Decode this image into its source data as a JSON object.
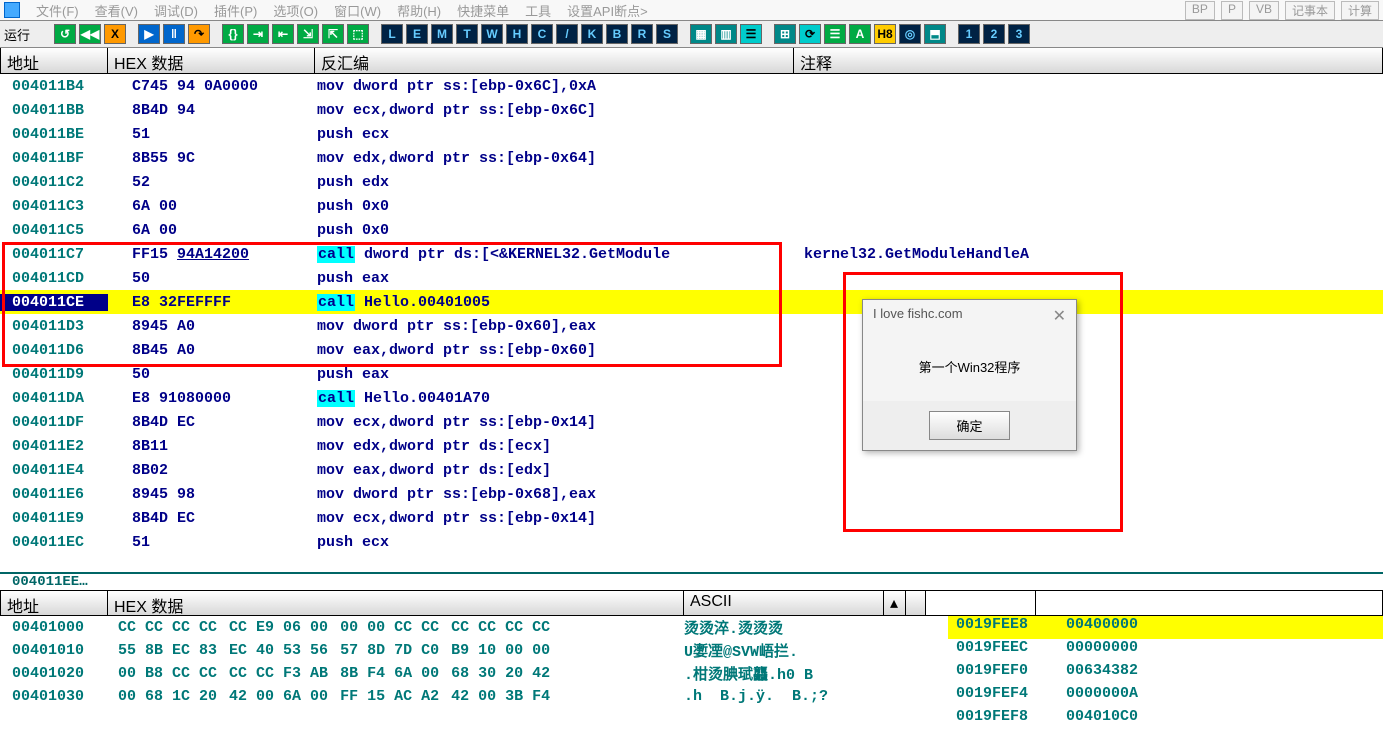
{
  "menu": {
    "items": [
      "文件(F)",
      "查看(V)",
      "调试(D)",
      "插件(P)",
      "选项(O)",
      "窗口(W)",
      "帮助(H)",
      "快捷菜单",
      "工具",
      "设置API断点>"
    ],
    "right": [
      "BP",
      "P",
      "VB",
      "记事本",
      "计算"
    ]
  },
  "toolbar": {
    "label": "运行",
    "buttons": [
      "↺",
      "◀◀",
      "X",
      "▶",
      "‖",
      "↷",
      "{}",
      "⇥",
      "⇤",
      "⇲",
      "⇱",
      "⬚",
      "L",
      "E",
      "M",
      "T",
      "W",
      "H",
      "C",
      "/",
      "K",
      "B",
      "R",
      "S",
      "▦",
      "▥",
      "☰",
      "⊞",
      "⟳",
      "☰",
      "A",
      "H8",
      "◎",
      "⬒",
      "1",
      "2",
      "3"
    ]
  },
  "headers": {
    "addr": "地址",
    "hex": "HEX 数据",
    "dis": "反汇编",
    "com": "注释"
  },
  "rows": [
    {
      "a": "004011B4",
      "h": "C745 94 0A0000",
      "d": "mov dword ptr ss:[ebp-0x6C],0xA",
      "c": ""
    },
    {
      "a": "004011BB",
      "h": "8B4D 94",
      "d": "mov ecx,dword ptr ss:[ebp-0x6C]",
      "c": ""
    },
    {
      "a": "004011BE",
      "h": "51",
      "d": "push ecx",
      "c": ""
    },
    {
      "a": "004011BF",
      "h": "8B55 9C",
      "d": "mov edx,dword ptr ss:[ebp-0x64]",
      "c": ""
    },
    {
      "a": "004011C2",
      "h": "52",
      "d": "push edx",
      "c": ""
    },
    {
      "a": "004011C3",
      "h": "6A 00",
      "d": "push 0x0",
      "c": ""
    },
    {
      "a": "004011C5",
      "h": "6A 00",
      "d": "push 0x0",
      "c": ""
    },
    {
      "a": "004011C7",
      "h": "FF15 ",
      "h2": "94A14200",
      "d1": "call",
      "d2": " dword ptr ds:[<&KERNEL32.GetModule",
      "c": "kernel32.GetModuleHandleA",
      "kw": true
    },
    {
      "a": "004011CD",
      "h": "50",
      "d": "push eax",
      "c": ""
    },
    {
      "a": "004011CE",
      "h": "E8 32FEFFFF",
      "d1": "call",
      "d2": " Hello.00401005",
      "c": "",
      "kw": true,
      "sel": true,
      "hl": true
    },
    {
      "a": "004011D3",
      "h": "8945 A0",
      "d": "mov dword ptr ss:[ebp-0x60],eax",
      "c": ""
    },
    {
      "a": "004011D6",
      "h": "8B45 A0",
      "d": "mov eax,dword ptr ss:[ebp-0x60]",
      "c": ""
    },
    {
      "a": "004011D9",
      "h": "50",
      "d": "push eax",
      "c": ""
    },
    {
      "a": "004011DA",
      "h": "E8 91080000",
      "d1": "call",
      "d2": " Hello.00401A70",
      "c": "",
      "kw": true
    },
    {
      "a": "004011DF",
      "h": "8B4D EC",
      "d": "mov ecx,dword ptr ss:[ebp-0x14]",
      "c": ""
    },
    {
      "a": "004011E2",
      "h": "8B11",
      "d": "mov edx,dword ptr ds:[ecx]",
      "c": ""
    },
    {
      "a": "004011E4",
      "h": "8B02",
      "d": "mov eax,dword ptr ds:[edx]",
      "c": ""
    },
    {
      "a": "004011E6",
      "h": "8945 98",
      "d": "mov dword ptr ss:[ebp-0x68],eax",
      "c": ""
    },
    {
      "a": "004011E9",
      "h": "8B4D EC",
      "d": "mov ecx,dword ptr ss:[ebp-0x14]",
      "c": ""
    },
    {
      "a": "004011EC",
      "h": "51",
      "d": "push ecx",
      "c": ""
    }
  ],
  "dumpHeaders": {
    "addr": "地址",
    "hex": "HEX 数据",
    "asc": "ASCII"
  },
  "dumpRows": [
    {
      "a": "00401000",
      "g": [
        "CC CC CC CC",
        "CC E9 06 00",
        "00 00 CC CC",
        "CC CC CC CC"
      ],
      "s": "烫烫淬.烫烫烫"
    },
    {
      "a": "00401010",
      "g": [
        "55 8B EC 83",
        "EC 40 53 56",
        "57 8D 7D C0",
        "B9 10 00 00"
      ],
      "s": "U嬱凐@SVW峿拦."
    },
    {
      "a": "00401020",
      "g": [
        "00 B8 CC CC",
        "CC CC F3 AB",
        "8B F4 6A 00",
        "68 30 20 42"
      ],
      "s": ".柑烫腆珷龘.h0 B"
    },
    {
      "a": "00401030",
      "g": [
        "00 68 1C 20",
        "42 00 6A 00",
        "FF 15 AC A2",
        "42 00 3B F4"
      ],
      "s": ".h  B.j.ÿ.  B.;?"
    }
  ],
  "stack": [
    {
      "a": "0019FEE8",
      "v": "00400000",
      "hl": true
    },
    {
      "a": "0019FEEC",
      "v": "00000000"
    },
    {
      "a": "0019FEF0",
      "v": "00634382"
    },
    {
      "a": "0019FEF4",
      "v": "0000000A"
    },
    {
      "a": "0019FEF8",
      "v": "004010C0"
    }
  ],
  "popup": {
    "title": "I love fishc.com",
    "body": "第一个Win32程序",
    "button": "确定"
  }
}
